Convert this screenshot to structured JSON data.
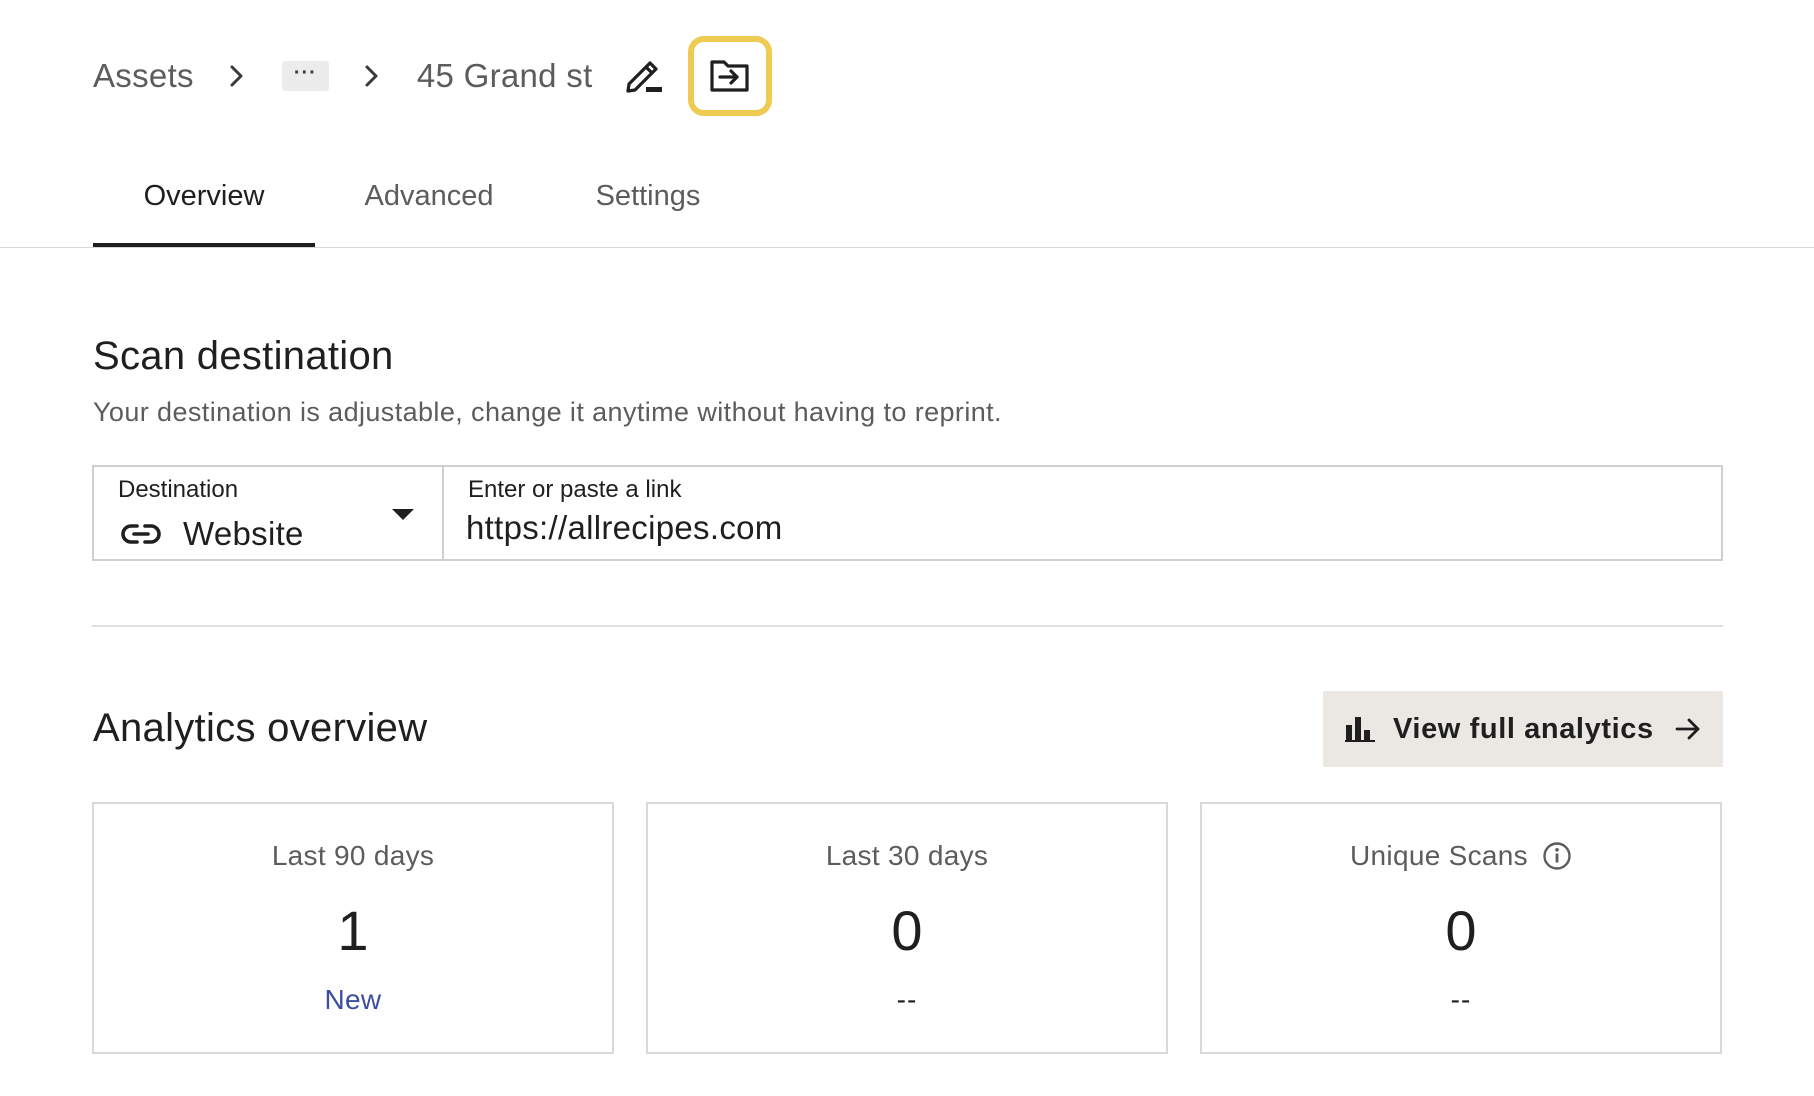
{
  "breadcrumb": {
    "root": "Assets",
    "ellipsis": "···",
    "current": "45 Grand st",
    "rename_icon": "pencil-edit-icon",
    "move_icon": "folder-move-icon"
  },
  "tabs": [
    {
      "label": "Overview",
      "active": true
    },
    {
      "label": "Advanced",
      "active": false
    },
    {
      "label": "Settings",
      "active": false
    }
  ],
  "scan_destination": {
    "title": "Scan destination",
    "subtitle": "Your destination is adjustable, change it anytime without having to reprint.",
    "destination_label": "Destination",
    "destination_value": "Website",
    "destination_icon": "link-icon",
    "link_label": "Enter or paste a link",
    "link_value": "https://allrecipes.com"
  },
  "analytics": {
    "title": "Analytics overview",
    "button_label": "View full analytics",
    "button_icon": "bar-chart-icon",
    "button_arrow_icon": "arrow-right-icon",
    "stats": [
      {
        "label": "Last 90 days",
        "value": "1",
        "sub": "New"
      },
      {
        "label": "Last 30 days",
        "value": "0",
        "sub": "--"
      },
      {
        "label": "Unique Scans",
        "value": "0",
        "sub": "--",
        "info_icon": "info-icon"
      }
    ]
  },
  "colors": {
    "highlight": "#efcb53",
    "accent_text": "#3d4ea0",
    "button_bg": "#ebe8e4"
  }
}
